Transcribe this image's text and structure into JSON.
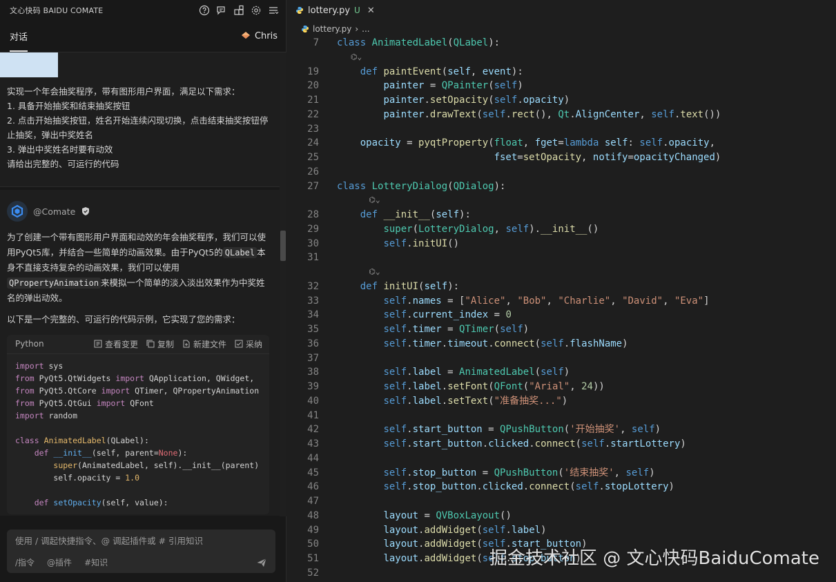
{
  "chat": {
    "title": "文心快码 BAIDU COMATE",
    "tab_dialog": "对话",
    "user_name": "Chris",
    "user_message": [
      "实现一个年会抽奖程序，带有图形用户界面，满足以下需求：",
      "1. 具备开始抽奖和结束抽奖按钮",
      "2. 点击开始抽奖按钮，姓名开始连续闪现切换，点击结束抽奖按钮停止抽奖，弹出中奖姓名",
      "3. 弹出中奖姓名时要有动效",
      "请给出完整的、可运行的代码"
    ],
    "bot_name": "@Comate",
    "bot_para1_a": "为了创建一个带有图形用户界面和动效的年会抽奖程序，我们可以使用PyQt5库，并结合一些简单的动画效果。由于PyQt5的",
    "bot_code1": "QLabel",
    "bot_para1_b": "本身不直接支持复杂的动画效果，我们可以使用",
    "bot_code2": "QPropertyAnimation",
    "bot_para1_c": "来模拟一个简单的淡入淡出效果作为中奖姓名的弹出动效。",
    "bot_para2": "以下是一个完整的、可运行的代码示例，它实现了您的需求：",
    "code_card": {
      "lang": "Python",
      "view_changes": "查看变更",
      "copy": "复制",
      "new_file": "新建文件",
      "accept": "采纳"
    },
    "input_placeholder": "使用 / 调起快捷指令、@ 调起插件或 # 引用知识",
    "input_tool_cmd": "/指令",
    "input_tool_plugin": "@插件",
    "input_tool_knowledge": "#知识"
  },
  "editor": {
    "tab_filename": "lottery.py",
    "tab_status": "U",
    "breadcrumb_file": "lottery.py",
    "breadcrumb_more": "..."
  },
  "watermark": "掘金技术社区 @ 文心快码BaiduComate",
  "icons": [
    "help-icon",
    "chat-history-icon",
    "plugin-icon",
    "settings-icon",
    "menu-icon",
    "shield-icon",
    "send-icon",
    "python-file-icon"
  ]
}
